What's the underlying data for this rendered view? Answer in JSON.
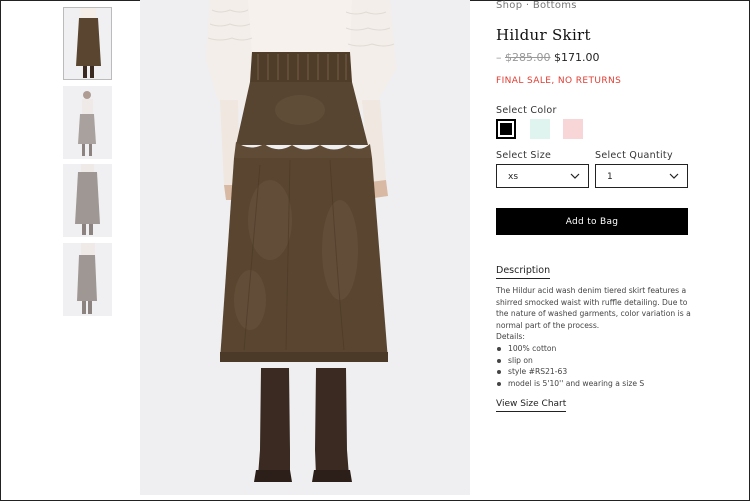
{
  "breadcrumb": {
    "shop": "Shop",
    "sep": "·",
    "bottoms": "Bottoms"
  },
  "product": {
    "title": "Hildur Skirt",
    "price_dash": "–",
    "original_price": "$285.00",
    "sale_price": "$171.00",
    "final_sale": "FINAL SALE, NO RETURNS"
  },
  "color": {
    "label": "Select Color",
    "swatches": [
      {
        "name": "black",
        "color": "#000000"
      },
      {
        "name": "mint",
        "color": "#dff3ef"
      },
      {
        "name": "pink",
        "color": "#f8d6d8"
      }
    ]
  },
  "size": {
    "label": "Select Size",
    "value": "xs"
  },
  "quantity": {
    "label": "Select Quantity",
    "value": "1"
  },
  "add_to_bag": "Add to Bag",
  "description": {
    "tab": "Description",
    "text": "The Hildur acid wash denim tiered skirt features a shirred smocked waist with ruffle detailing. Due to the nature of washed garments, color variation is a normal part of the process.",
    "details_label": "Details:",
    "details": [
      "100% cotton",
      "slip on",
      "style #RS21-63",
      "model is 5'10'' and wearing a size S"
    ]
  },
  "size_chart": "View Size Chart",
  "colors": {
    "sale_red": "#e03c31",
    "button_black": "#000000",
    "skirt_brown": "#5a4630"
  }
}
